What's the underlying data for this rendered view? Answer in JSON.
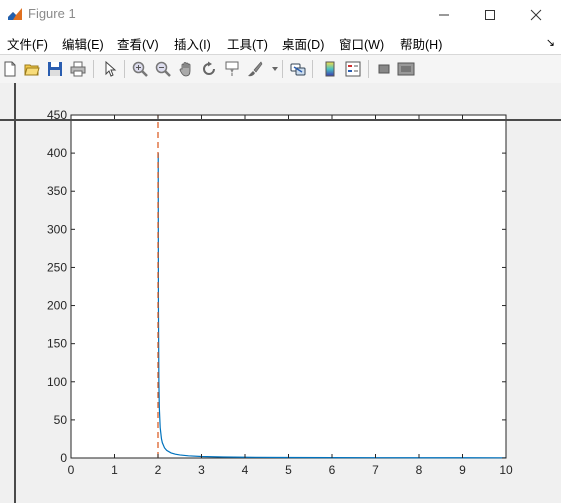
{
  "window": {
    "title": "Figure 1"
  },
  "menu": {
    "items": [
      "文件(F)",
      "编辑(E)",
      "查看(V)",
      "插入(I)",
      "工具(T)",
      "桌面(D)",
      "窗口(W)",
      "帮助(H)"
    ],
    "extra": "↘"
  },
  "toolbar": {
    "icons": [
      "new-figure-icon",
      "open-file-icon",
      "save-icon",
      "print-icon",
      "select-arrow-icon",
      "zoom-in-icon",
      "zoom-out-icon",
      "pan-hand-icon",
      "rotate-3d-icon",
      "data-cursor-icon",
      "brush-icon",
      "link-plot-icon",
      "colorbar-icon",
      "legend-icon",
      "hide-plot-tools-icon",
      "show-plot-tools-icon"
    ]
  },
  "chart_data": {
    "type": "line",
    "title": "",
    "xlabel": "",
    "ylabel": "",
    "xlim": [
      0,
      10
    ],
    "ylim": [
      0,
      450
    ],
    "xticks": [
      "0",
      "1",
      "2",
      "3",
      "4",
      "5",
      "6",
      "7",
      "8",
      "9",
      "10"
    ],
    "yticks": [
      "0",
      "50",
      "100",
      "150",
      "200",
      "250",
      "300",
      "350",
      "400",
      "450"
    ],
    "grid": false,
    "series": [
      {
        "color": "#0072BD",
        "style": "solid",
        "x": [
          2.005,
          2.01,
          2.02,
          2.03,
          2.05,
          2.08,
          2.1,
          2.15,
          2.2,
          2.3,
          2.4,
          2.5,
          2.7,
          3,
          3.5,
          4,
          5,
          6,
          7,
          8,
          9,
          10
        ],
        "y": [
          400,
          200,
          100,
          66.7,
          40,
          25,
          20,
          13.3,
          10,
          6.7,
          5,
          4,
          2.9,
          2,
          1.3,
          1,
          0.67,
          0.5,
          0.4,
          0.33,
          0.29,
          0.25
        ]
      },
      {
        "color": "#D95319",
        "style": "dashed",
        "x": [
          2,
          2
        ],
        "y": [
          0,
          450
        ]
      }
    ]
  }
}
